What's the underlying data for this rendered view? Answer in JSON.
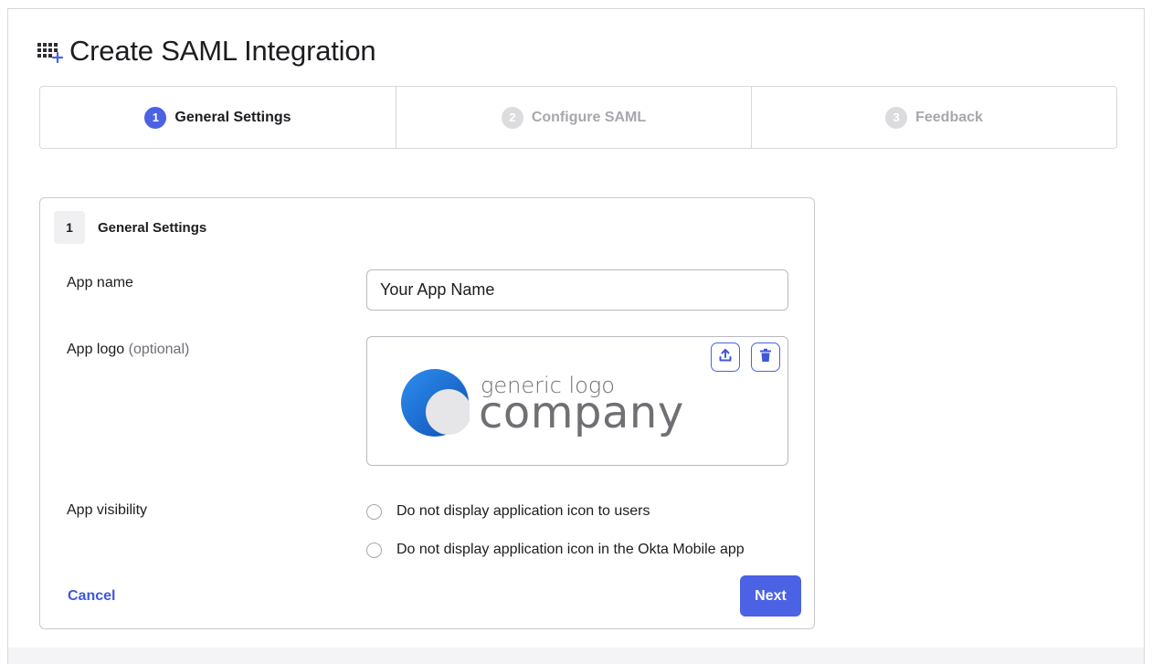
{
  "page": {
    "title": "Create SAML Integration"
  },
  "steps": [
    {
      "number": "1",
      "label": "General Settings",
      "state": "active"
    },
    {
      "number": "2",
      "label": "Configure SAML",
      "state": "inactive"
    },
    {
      "number": "3",
      "label": "Feedback",
      "state": "inactive"
    }
  ],
  "card": {
    "number": "1",
    "title": "General Settings",
    "app_name_label": "App name",
    "app_name_value": "Your App Name",
    "app_logo_label": "App logo",
    "app_logo_optional": "(optional)",
    "logo": {
      "line1": "generic logo",
      "line2": "company"
    },
    "app_visibility_label": "App visibility",
    "visibility_options": [
      {
        "label": "Do not display application icon to users",
        "checked": false
      },
      {
        "label": "Do not display application icon in the Okta Mobile app",
        "checked": false
      }
    ],
    "cancel_label": "Cancel",
    "next_label": "Next"
  },
  "icons": {
    "title_icon": "app-grid-add-icon",
    "upload": "upload-icon",
    "delete": "trash-icon"
  },
  "colors": {
    "accent": "#4b62e4",
    "link": "#3f57d9",
    "inactive_step": "#a7a7ad",
    "logo_blue": "#1f74d8"
  }
}
